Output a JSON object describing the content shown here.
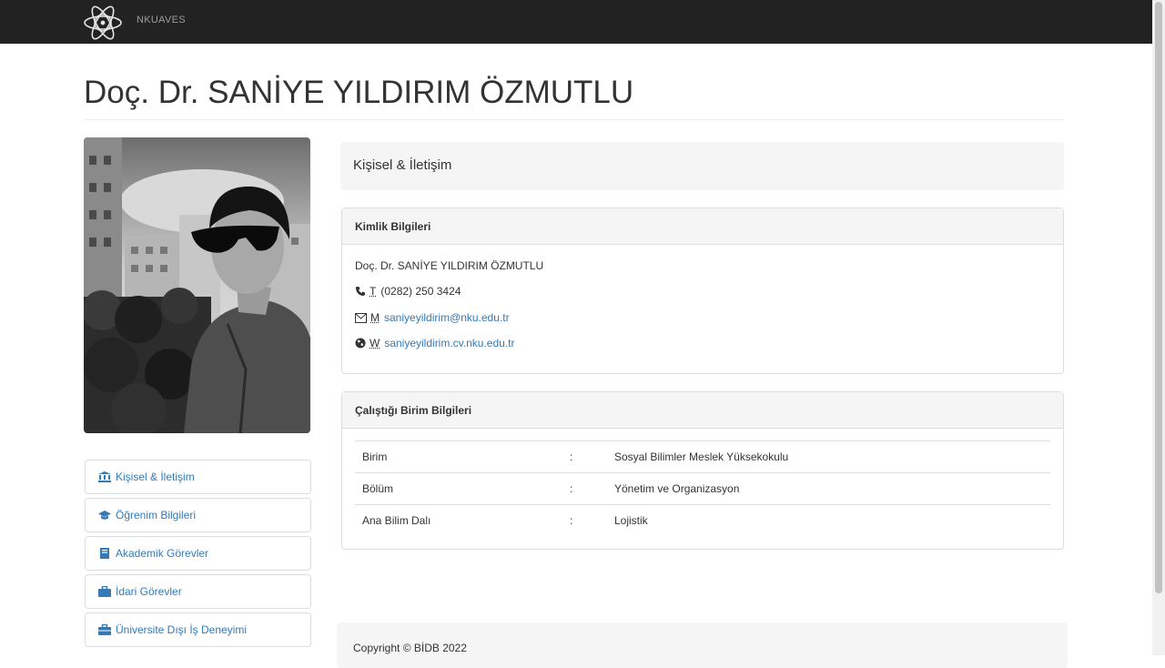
{
  "nav": {
    "brand_text": "NKUAVES",
    "logo_icon": "atom-logo-icon"
  },
  "page": {
    "title": "Doç. Dr. SANİYE YILDIRIM ÖZMUTLU"
  },
  "sidebar": {
    "items": [
      {
        "label": "Kişisel & İletişim",
        "icon": "institution-icon"
      },
      {
        "label": "Öğrenim Bilgileri",
        "icon": "graduation-cap-icon"
      },
      {
        "label": "Akademik Görevler",
        "icon": "book-icon"
      },
      {
        "label": "İdari Görevler",
        "icon": "briefcase-icon"
      },
      {
        "label": "Üniversite Dışı İş Deneyimi",
        "icon": "suitcase-icon"
      }
    ]
  },
  "main": {
    "section_title": "Kişisel & İletişim",
    "identity": {
      "heading": "Kimlik Bilgileri",
      "name": "Doç. Dr. SANİYE YILDIRIM ÖZMUTLU",
      "phone_abbr": "T",
      "phone": "(0282) 250 3424",
      "email_abbr": "M",
      "email": "saniyeyildirim@nku.edu.tr",
      "web_abbr": "W",
      "web": "saniyeyildirim.cv.nku.edu.tr"
    },
    "unit": {
      "heading": "Çalıştığı Birim Bilgileri",
      "rows": [
        {
          "label": "Birim",
          "sep": ":",
          "value": "Sosyal Bilimler Meslek Yüksekokulu"
        },
        {
          "label": "Bölüm",
          "sep": ":",
          "value": "Yönetim ve Organizasyon"
        },
        {
          "label": "Ana Bilim Dalı",
          "sep": ":",
          "value": "Lojistik"
        }
      ]
    }
  },
  "footer": {
    "text": "Copyright © BİDB 2022"
  },
  "colors": {
    "navbar": "#222222",
    "link": "#337ab7",
    "panel_bg": "#f5f5f5",
    "border": "#dddddd"
  }
}
